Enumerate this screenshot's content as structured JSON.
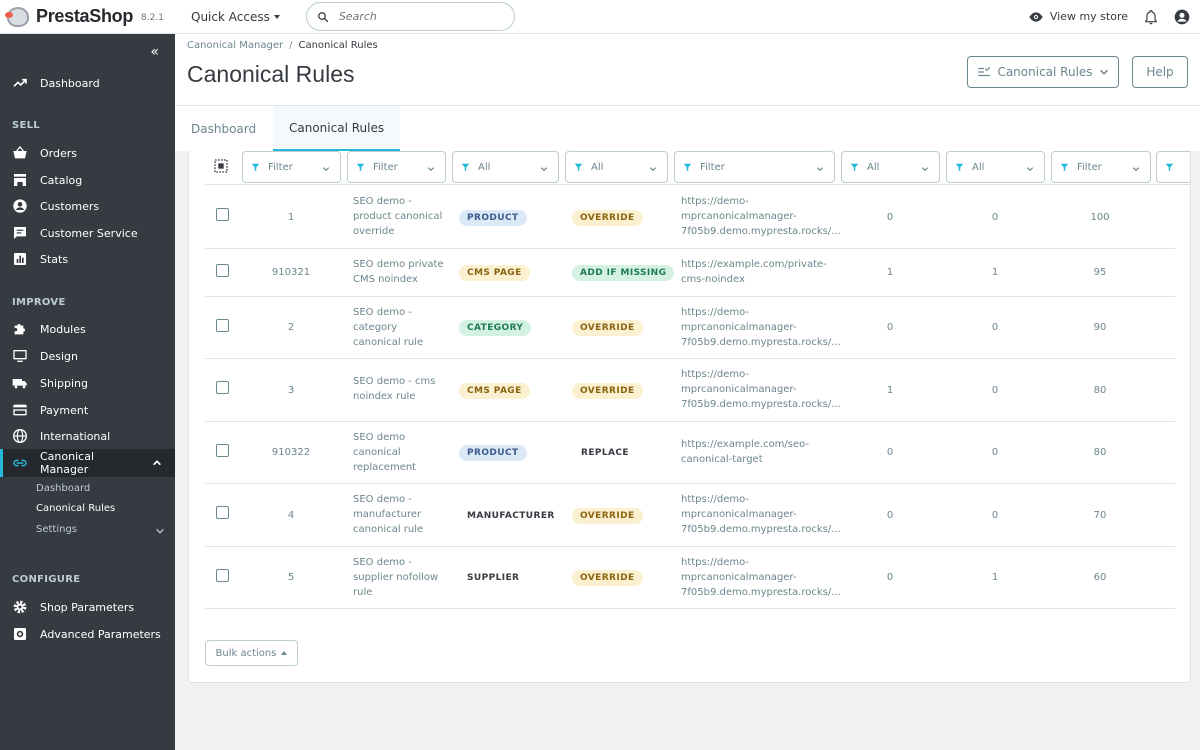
{
  "header": {
    "logo_text": "PrestaShop",
    "version": "8.2.1",
    "quick_access": "Quick Access",
    "search_placeholder": "Search",
    "view_store": "View my store"
  },
  "sidebar": {
    "collapse_icon": "double-chevron-left",
    "dashboard": "Dashboard",
    "sections": {
      "sell": "SELL",
      "improve": "IMPROVE",
      "configure": "CONFIGURE"
    },
    "sell_items": [
      "Orders",
      "Catalog",
      "Customers",
      "Customer Service",
      "Stats"
    ],
    "improve_items": [
      "Modules",
      "Design",
      "Shipping",
      "Payment",
      "International"
    ],
    "active_item": "Canonical Manager",
    "sub_items": [
      "Dashboard",
      "Canonical Rules",
      "Settings"
    ],
    "configure_items": [
      "Shop Parameters",
      "Advanced Parameters"
    ]
  },
  "page": {
    "breadcrumb_parent": "Canonical Manager",
    "breadcrumb_sep": "/",
    "breadcrumb_current": "Canonical Rules",
    "title": "Canonical Rules",
    "canonical_button": "Canonical Rules",
    "help_button": "Help"
  },
  "tabs": [
    "Dashboard",
    "Canonical Rules"
  ],
  "filters": [
    "Filter",
    "Filter",
    "All",
    "All",
    "Filter",
    "All",
    "All",
    "Filter"
  ],
  "rows": [
    {
      "id": "1",
      "name": "SEO demo - product canonical override",
      "type": "PRODUCT",
      "action": "OVERRIDE",
      "url": "https://demo-mprcanonicalmanager-7f05b9.demo.mypresta.rocks/...",
      "a": "0",
      "b": "0",
      "priority": "100"
    },
    {
      "id": "910321",
      "name": "SEO demo private CMS noindex",
      "type": "CMS PAGE",
      "action": "ADD IF MISSING",
      "url": "https://example.com/private-cms-noindex",
      "a": "1",
      "b": "1",
      "priority": "95"
    },
    {
      "id": "2",
      "name": "SEO demo - category canonical rule",
      "type": "CATEGORY",
      "action": "OVERRIDE",
      "url": "https://demo-mprcanonicalmanager-7f05b9.demo.mypresta.rocks/...",
      "a": "0",
      "b": "0",
      "priority": "90"
    },
    {
      "id": "3",
      "name": "SEO demo - cms noindex rule",
      "type": "CMS PAGE",
      "action": "OVERRIDE",
      "url": "https://demo-mprcanonicalmanager-7f05b9.demo.mypresta.rocks/...",
      "a": "1",
      "b": "0",
      "priority": "80"
    },
    {
      "id": "910322",
      "name": "SEO demo canonical replacement",
      "type": "PRODUCT",
      "action": "REPLACE",
      "url": "https://example.com/seo-canonical-target",
      "a": "0",
      "b": "0",
      "priority": "80"
    },
    {
      "id": "4",
      "name": "SEO demo - manufacturer canonical rule",
      "type": "MANUFACTURER",
      "action": "OVERRIDE",
      "url": "https://demo-mprcanonicalmanager-7f05b9.demo.mypresta.rocks/...",
      "a": "0",
      "b": "0",
      "priority": "70"
    },
    {
      "id": "5",
      "name": "SEO demo - supplier nofollow rule",
      "type": "SUPPLIER",
      "action": "OVERRIDE",
      "url": "https://demo-mprcanonicalmanager-7f05b9.demo.mypresta.rocks/...",
      "a": "0",
      "b": "1",
      "priority": "60"
    }
  ],
  "bulk_actions": "Bulk actions",
  "colors": {
    "accent": "#25b9d7",
    "sidebar": "#363a41",
    "badge_blue": "#dbe8f5",
    "badge_yellow": "#fbf0cf",
    "badge_green": "#d4f1e4"
  }
}
